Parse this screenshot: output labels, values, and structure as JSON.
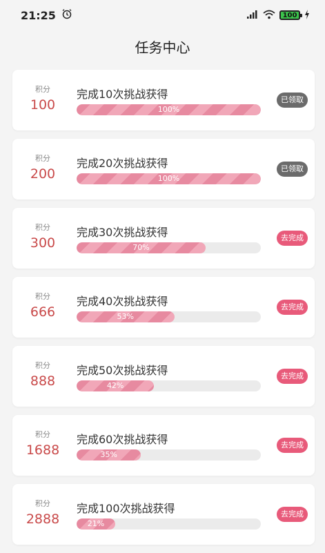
{
  "status_bar": {
    "time": "21:25",
    "battery": "100"
  },
  "header": {
    "title": "任务中心"
  },
  "tasks": [
    {
      "points_label": "积分",
      "points": "100",
      "title": "完成10次挑战获得",
      "progress": 100,
      "progress_text": "100%",
      "status": "已领取",
      "state": "claimed"
    },
    {
      "points_label": "积分",
      "points": "200",
      "title": "完成20次挑战获得",
      "progress": 100,
      "progress_text": "100%",
      "status": "已领取",
      "state": "claimed"
    },
    {
      "points_label": "积分",
      "points": "300",
      "title": "完成30次挑战获得",
      "progress": 70,
      "progress_text": "70%",
      "status": "去完成",
      "state": "todo"
    },
    {
      "points_label": "积分",
      "points": "666",
      "title": "完成40次挑战获得",
      "progress": 53,
      "progress_text": "53%",
      "status": "去完成",
      "state": "todo"
    },
    {
      "points_label": "积分",
      "points": "888",
      "title": "完成50次挑战获得",
      "progress": 42,
      "progress_text": "42%",
      "status": "去完成",
      "state": "todo"
    },
    {
      "points_label": "积分",
      "points": "1688",
      "title": "完成60次挑战获得",
      "progress": 35,
      "progress_text": "35%",
      "status": "去完成",
      "state": "todo"
    },
    {
      "points_label": "积分",
      "points": "2888",
      "title": "完成100次挑战获得",
      "progress": 21,
      "progress_text": "21%",
      "status": "去完成",
      "state": "todo"
    }
  ]
}
